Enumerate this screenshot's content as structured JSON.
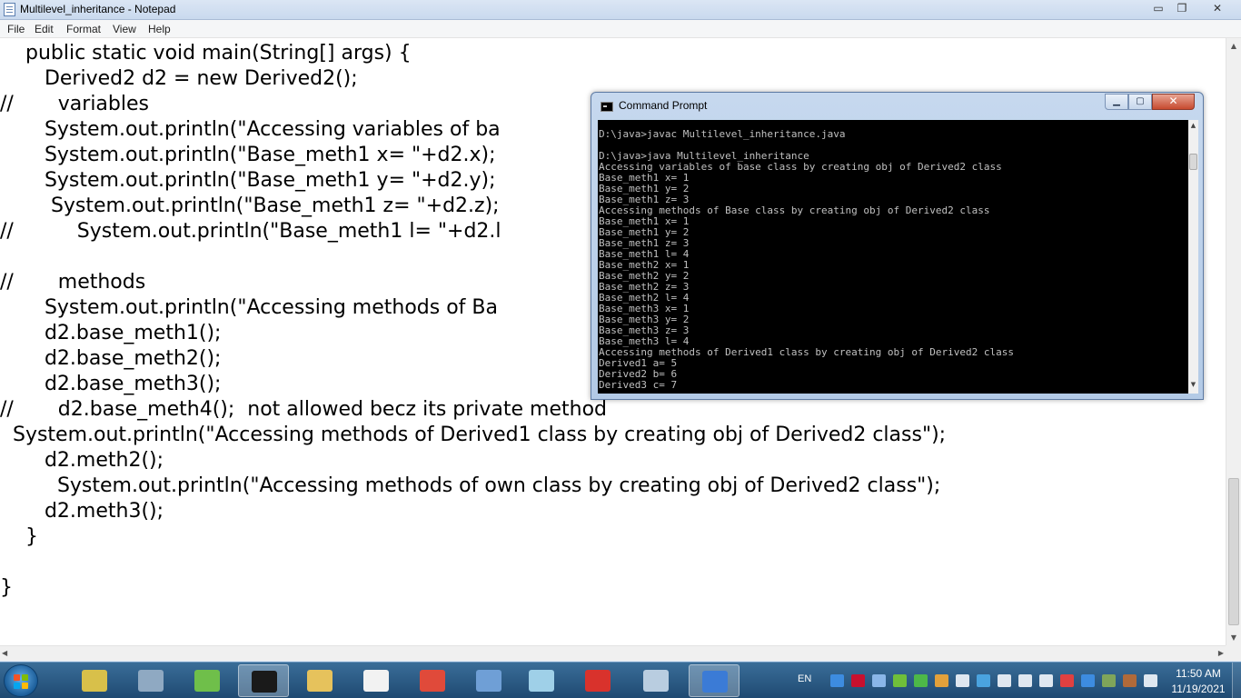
{
  "notepad": {
    "title": "Multilevel_inheritance - Notepad",
    "caption": {
      "minimize": "▭",
      "maximize": "❐",
      "close": "✕"
    },
    "menu": [
      "File",
      "Edit",
      "Format",
      "View",
      "Help"
    ],
    "code_lines": [
      "    public static void main(String[] args) {",
      "       Derived2 d2 = new Derived2();",
      "//       variables",
      "       System.out.println(\"Accessing variables of ba",
      "       System.out.println(\"Base_meth1 x= \"+d2.x);",
      "       System.out.println(\"Base_meth1 y= \"+d2.y);",
      "        System.out.println(\"Base_meth1 z= \"+d2.z);",
      "//          System.out.println(\"Base_meth1 l= \"+d2.l",
      "",
      "//       methods",
      "       System.out.println(\"Accessing methods of Ba",
      "       d2.base_meth1();",
      "       d2.base_meth2();",
      "       d2.base_meth3();",
      "//       d2.base_meth4();  not allowed becz its private method",
      "  System.out.println(\"Accessing methods of Derived1 class by creating obj of Derived2 class\");",
      "       d2.meth2();",
      "         System.out.println(\"Accessing methods of own class by creating obj of Derived2 class\");",
      "       d2.meth3();",
      "    }",
      "",
      "}"
    ]
  },
  "cmd": {
    "title": "Command Prompt",
    "caption": {
      "minimize": "▁",
      "maximize": "▢",
      "close": "✕"
    },
    "lines": [
      "D:\\java>javac Multilevel_inheritance.java",
      "",
      "D:\\java>java Multilevel_inheritance",
      "Accessing variables of base class by creating obj of Derived2 class",
      "Base_meth1 x= 1",
      "Base_meth1 y= 2",
      "Base_meth1 z= 3",
      "Accessing methods of Base class by creating obj of Derived2 class",
      "Base_meth1 x= 1",
      "Base_meth1 y= 2",
      "Base_meth1 z= 3",
      "Base_meth1 l= 4",
      "Base_meth2 x= 1",
      "Base_meth2 y= 2",
      "Base_meth2 z= 3",
      "Base_meth2 l= 4",
      "Base_meth3 x= 1",
      "Base_meth3 y= 2",
      "Base_meth3 z= 3",
      "Base_meth3 l= 4",
      "Accessing methods of Derived1 class by creating obj of Derived2 class",
      "Derived1 a= 5",
      "Derived2 b= 6",
      "Derived3 c= 7"
    ]
  },
  "taskbar": {
    "apps": [
      {
        "name": "explorer-folders",
        "color": "#d8c04a",
        "active": false
      },
      {
        "name": "computer",
        "color": "#8fa9c2",
        "active": false
      },
      {
        "name": "notepad-plus",
        "color": "#6fbf4a",
        "active": false
      },
      {
        "name": "command-prompt",
        "color": "#1a1a1a",
        "active": true
      },
      {
        "name": "file-explorer",
        "color": "#e6c25c",
        "active": false
      },
      {
        "name": "media-player-321",
        "color": "#f2f2f2",
        "active": false
      },
      {
        "name": "chrome",
        "color": "#e04a3a",
        "active": false
      },
      {
        "name": "virtualbox",
        "color": "#6f9fd6",
        "active": false
      },
      {
        "name": "notepad",
        "color": "#9fd0e8",
        "active": false
      },
      {
        "name": "wps-pdf",
        "color": "#d9322c",
        "active": false
      },
      {
        "name": "paint",
        "color": "#b9cde0",
        "active": false
      },
      {
        "name": "paint-3d",
        "color": "#3b7bd6",
        "active": true
      }
    ],
    "language": "EN",
    "tray_icons": [
      {
        "name": "help-icon",
        "color": "#3d8ce0"
      },
      {
        "name": "mcafee-icon",
        "color": "#c8102e"
      },
      {
        "name": "cloud-icon",
        "color": "#8ab6e8"
      },
      {
        "name": "utorrent-icon",
        "color": "#6fbf3a"
      },
      {
        "name": "shield-icon",
        "color": "#4db848"
      },
      {
        "name": "folder-icon",
        "color": "#e3a13b"
      },
      {
        "name": "signal-icon",
        "color": "#dfe7f0"
      },
      {
        "name": "network-icon",
        "color": "#4aa3df"
      },
      {
        "name": "volume-icon",
        "color": "#dfe7f0"
      },
      {
        "name": "battery-icon",
        "color": "#dfe7f0"
      },
      {
        "name": "move-icon",
        "color": "#dfe7f0"
      },
      {
        "name": "flag-icon",
        "color": "#e04040"
      },
      {
        "name": "bluetooth-icon",
        "color": "#3d8ce0"
      },
      {
        "name": "drive-icon",
        "color": "#7fa55a"
      },
      {
        "name": "tools-icon",
        "color": "#b06a3a"
      },
      {
        "name": "display-icon",
        "color": "#dfe7f0"
      }
    ],
    "clock_time": "11:50 AM",
    "clock_date": "11/19/2021"
  }
}
